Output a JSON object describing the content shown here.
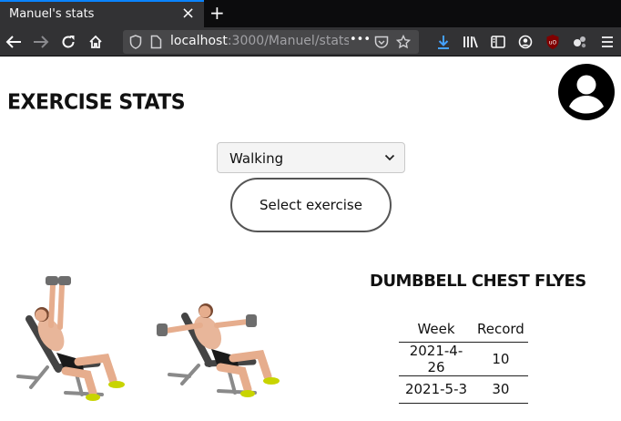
{
  "browser": {
    "tab_title": "Manuel's stats",
    "tab_close": "×",
    "new_tab": "+",
    "url_host": "localhost",
    "url_rest": ":3000/Manuel/stats",
    "page_actions": "•••"
  },
  "page": {
    "title": "EXERCISE STATS",
    "exercise_select": {
      "value": "Walking"
    },
    "select_button_label": "Select exercise",
    "exercise_name": "DUMBBELL CHEST FLYES",
    "stats": {
      "headers": [
        "Week",
        "Record"
      ],
      "rows": [
        [
          "2021-4-26",
          "10"
        ],
        [
          "2021-5-3",
          "30"
        ]
      ]
    }
  },
  "colors": {
    "accent": "#0a84ff",
    "chrome_dark": "#0c0c0d",
    "toolbar": "#323234"
  },
  "icons": [
    "back-icon",
    "forward-icon",
    "reload-icon",
    "home-icon",
    "shield-icon",
    "page-icon",
    "pocket-icon",
    "bookmark-star-icon",
    "download-icon",
    "library-icon",
    "sidebar-icon",
    "account-icon",
    "ublock-icon",
    "extension-icon",
    "menu-icon",
    "avatar-icon",
    "chevron-down-icon"
  ]
}
